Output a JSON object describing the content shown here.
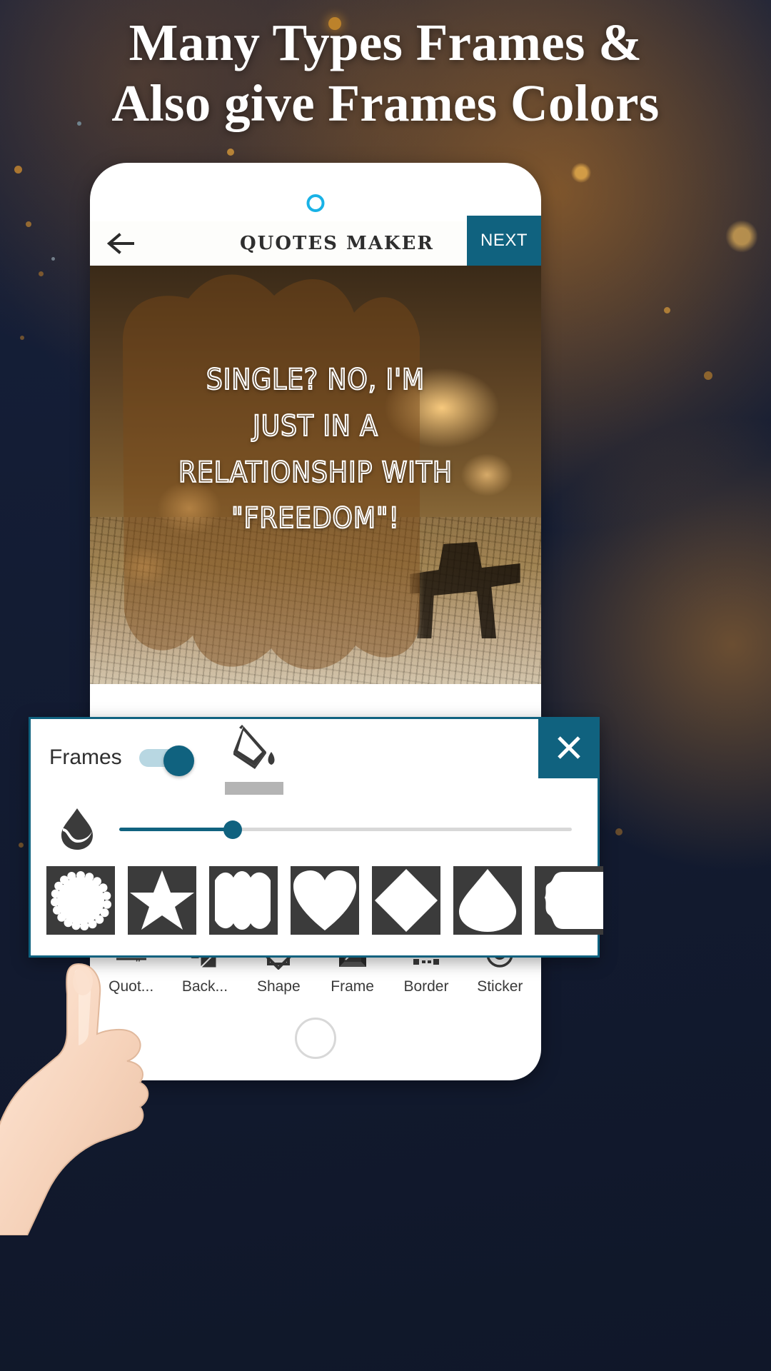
{
  "promo": {
    "headline_line1": "Many Types Frames &",
    "headline_line2": "Also give Frames Colors"
  },
  "app": {
    "title": "QUOTES MAKER",
    "back_icon": "back-arrow-icon",
    "next_label": "NEXT"
  },
  "canvas": {
    "quote_line1": "SINGLE? NO, I'M",
    "quote_line2": "JUST IN A",
    "quote_line3": "RELATIONSHIP WITH",
    "quote_line4": "\"FREEDOM\"!"
  },
  "frames_panel": {
    "title": "Frames",
    "toggle_state": "on",
    "fill_icon": "paint-bucket-icon",
    "swatch_color": "#b4b4b4",
    "close_icon": "close-icon",
    "opacity_icon": "opacity-droplet-icon",
    "opacity_value": 25,
    "shapes": [
      {
        "name": "scalloped-circle"
      },
      {
        "name": "star"
      },
      {
        "name": "wavy-square"
      },
      {
        "name": "heart"
      },
      {
        "name": "diamond"
      },
      {
        "name": "droplet"
      },
      {
        "name": "bracket-frame"
      }
    ]
  },
  "toolbar": {
    "items": [
      {
        "label": "Quot...",
        "icon": "quote-icon"
      },
      {
        "label": "Back...",
        "icon": "background-icon"
      },
      {
        "label": "Shape",
        "icon": "shape-icon"
      },
      {
        "label": "Frame",
        "icon": "frame-icon"
      },
      {
        "label": "Border",
        "icon": "border-icon"
      },
      {
        "label": "Sticker",
        "icon": "sticker-smiley-icon"
      }
    ]
  },
  "colors": {
    "accent": "#10627f",
    "background": "#131c33",
    "camera_dot": "#19b2e6"
  }
}
